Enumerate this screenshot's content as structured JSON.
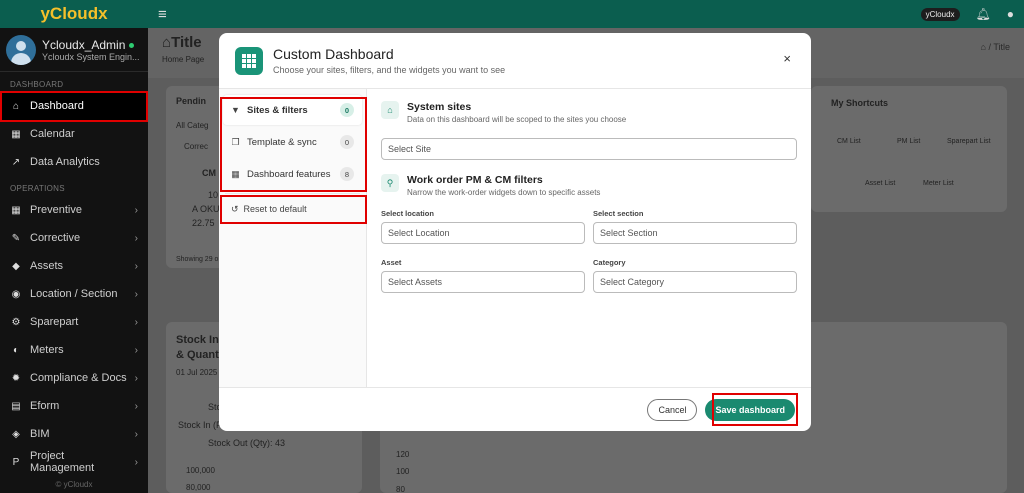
{
  "brand": "yCloudx",
  "user": {
    "name": "Ycloudx_Admin",
    "role": "Ycloudx System Engin..."
  },
  "sidebar": {
    "section_dashboard": "DASHBOARD",
    "section_operations": "OPERATIONS",
    "items_top": [
      {
        "label": "Dashboard",
        "icon": "home-icon"
      },
      {
        "label": "Calendar",
        "icon": "calendar-icon"
      },
      {
        "label": "Data Analytics",
        "icon": "chart-icon"
      }
    ],
    "items_ops": [
      {
        "label": "Preventive"
      },
      {
        "label": "Corrective"
      },
      {
        "label": "Assets"
      },
      {
        "label": "Location / Section"
      },
      {
        "label": "Sparepart"
      },
      {
        "label": "Meters"
      },
      {
        "label": "Compliance & Docs"
      },
      {
        "label": "Eform"
      },
      {
        "label": "BIM"
      },
      {
        "label": "Project Management"
      }
    ],
    "footer": "© yCloudx"
  },
  "topbar": {
    "pill": "yCloudx"
  },
  "page": {
    "title": "Title",
    "subtitle": "Home Page",
    "breadcrumb": "/ Title"
  },
  "background": {
    "pending": "Pendin",
    "all_categ": "All Categ",
    "corrective": "Correc",
    "cm": "CM",
    "cm_num": "10",
    "cm_line": "A OKU",
    "cm_val": "22.75",
    "showing": "Showing 29 o",
    "shortcuts_title": "My Shortcuts",
    "shortcuts": [
      "CM List",
      "PM List",
      "Sparepart List",
      "Asset List",
      "Meter List"
    ],
    "stock_title1": "Stock In",
    "stock_title2": "& Quant",
    "stock_date": "01 Jul 2025",
    "legend_sto": "Sto",
    "stock_in": "Stock In (F",
    "stock_out": "Stock Out (Qty): 43",
    "axis_left": [
      "100,000",
      "80,000"
    ],
    "axis_right": [
      "120",
      "100",
      "80"
    ]
  },
  "modal": {
    "title": "Custom Dashboard",
    "subtitle": "Choose your sites, filters, and the widgets you want to see",
    "close": "×",
    "tabs": [
      {
        "label": "Sites & filters",
        "count": "0"
      },
      {
        "label": "Template & sync",
        "count": "0"
      },
      {
        "label": "Dashboard features",
        "count": "8"
      }
    ],
    "reset": "Reset to default",
    "system_sites": {
      "title": "System sites",
      "subtitle": "Data on this dashboard will be scoped to the sites you choose",
      "placeholder": "Select Site"
    },
    "workorder": {
      "title": "Work order PM & CM filters",
      "subtitle": "Narrow the work-order widgets down to specific assets",
      "location_label": "Select location",
      "location_placeholder": "Select Location",
      "section_label": "Select section",
      "section_placeholder": "Select Section",
      "asset_label": "Asset",
      "asset_placeholder": "Select Assets",
      "category_label": "Category",
      "category_placeholder": "Select Category"
    },
    "cancel": "Cancel",
    "save": "Save dashboard"
  }
}
